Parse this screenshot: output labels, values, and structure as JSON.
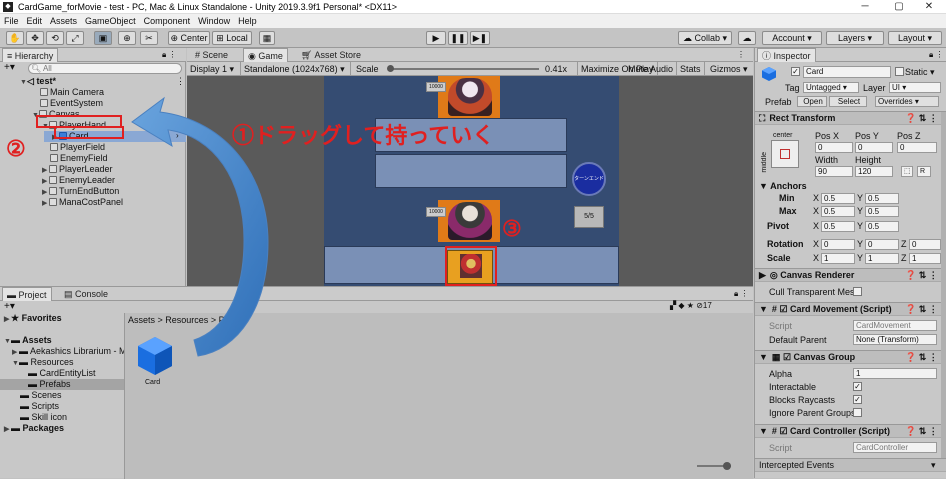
{
  "window": {
    "title": "CardGame_forMovie - test - PC, Mac & Linux Standalone - Unity 2019.3.9f1 Personal* <DX11>",
    "minimize": "─",
    "restore": "▢",
    "close": "✕"
  },
  "menu": [
    "File",
    "Edit",
    "Assets",
    "GameObject",
    "Component",
    "Window",
    "Help"
  ],
  "toolbar": {
    "center": "Center",
    "local": "Local",
    "collab": "Collab ▾",
    "account": "Account ▾",
    "layers": "Layers ▾",
    "layout": "Layout ▾"
  },
  "hierarchy": {
    "tab": "Hierarchy",
    "search": "All",
    "scene": "test*",
    "items": [
      "Main Camera",
      "EventSystem",
      "Canvas",
      "PlayerHand",
      "Card",
      "PlayerField",
      "EnemyField",
      "PlayerLeader",
      "EnemyLeader",
      "TurnEndButton",
      "ManaCostPanel"
    ]
  },
  "game": {
    "tabs": [
      "Scene",
      "Game",
      "Asset Store"
    ],
    "display": "Display 1",
    "resolution": "Standalone (1024x768)",
    "scale_label": "Scale",
    "scale_value": "0.41x",
    "maximize": "Maximize On Play",
    "mute": "Mute Audio",
    "stats": "Stats",
    "gizmos": "Gizmos ▾",
    "enemy_hp": "10000",
    "player_hp": "10000",
    "turn_end": "ターンエンド",
    "mana": "5/5"
  },
  "project": {
    "tabs": [
      "Project",
      "Console"
    ],
    "favorites": "Favorites",
    "assets": "Assets",
    "tree": [
      "Aekashics Librarium - M",
      "Resources",
      "CardEntityList",
      "Prefabs",
      "Scenes",
      "Scripts",
      "Skill icon"
    ],
    "packages": "Packages",
    "breadcrumb": [
      "Assets",
      "Resources",
      "P"
    ],
    "count": "17",
    "asset_name": "Card"
  },
  "inspector": {
    "tab": "Inspector",
    "name": "Card",
    "static": "Static ▾",
    "tag_label": "Tag",
    "tag": "Untagged",
    "layer_label": "Layer",
    "layer": "UI",
    "prefab": "Prefab",
    "open": "Open",
    "select": "Select",
    "overrides": "Overrides",
    "rect": {
      "title": "Rect Transform",
      "anchor_h": "center",
      "anchor_v": "middle",
      "posx_l": "Pos X",
      "posy_l": "Pos Y",
      "posz_l": "Pos Z",
      "posx": "0",
      "posy": "0",
      "posz": "0",
      "width_l": "Width",
      "height_l": "Height",
      "width": "90",
      "height": "120",
      "anchors": "Anchors",
      "min": "Min",
      "max": "Max",
      "pivot": "Pivot",
      "rotation": "Rotation",
      "scale": "Scale",
      "ax": "X",
      "ay": "Y",
      "az": "Z",
      "half": "0.5",
      "zero": "0",
      "one": "1",
      "r": "R"
    },
    "canvas_renderer": {
      "title": "Canvas Renderer",
      "cull": "Cull Transparent Mes"
    },
    "card_movement": {
      "title": "Card Movement (Script)",
      "script_l": "Script",
      "script": "CardMovement",
      "parent_l": "Default Parent",
      "parent": "None (Transform)"
    },
    "canvas_group": {
      "title": "Canvas Group",
      "alpha_l": "Alpha",
      "alpha": "1",
      "interactable": "Interactable",
      "blocks": "Blocks Raycasts",
      "ignore": "Ignore Parent Groups"
    },
    "card_controller": {
      "title": "Card Controller (Script)",
      "script_l": "Script",
      "script": "CardController"
    },
    "events": "Intercepted Events"
  },
  "annotations": {
    "a1": "①ドラッグして持っていく",
    "a2": "②",
    "a3": "③"
  }
}
